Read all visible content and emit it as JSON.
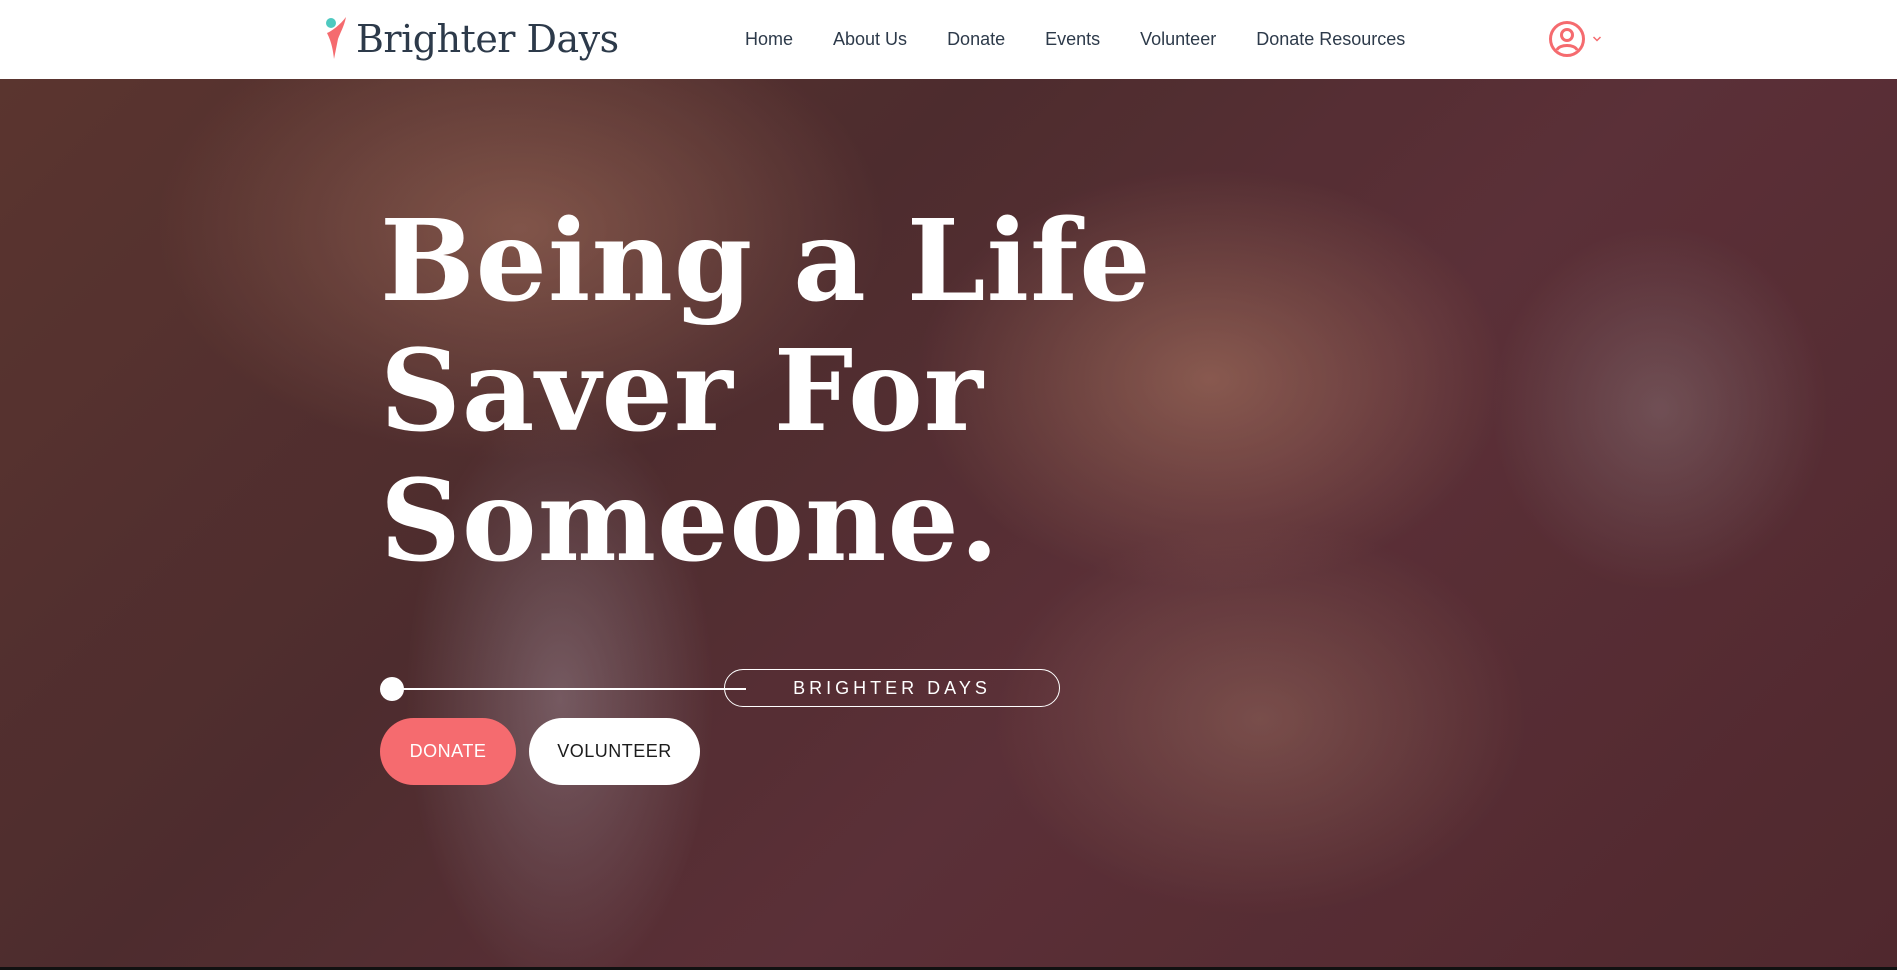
{
  "brand": {
    "name": "Brighter Days",
    "accent_color": "#f56b6f",
    "teal_color": "#4ec9c0",
    "text_color": "#2d3a4a",
    "logo_icon": "figure-icon"
  },
  "nav": {
    "items": [
      {
        "label": "Home"
      },
      {
        "label": "About Us"
      },
      {
        "label": "Donate"
      },
      {
        "label": "Events"
      },
      {
        "label": "Volunteer"
      },
      {
        "label": "Donate Resources"
      }
    ]
  },
  "account": {
    "icon": "user-circle-icon",
    "dropdown_icon": "chevron-down-icon"
  },
  "hero": {
    "title_lines": [
      "Being a Life",
      "Saver For",
      "Someone."
    ],
    "tagline": "BRIGHTER DAYS",
    "background": "photo-stacked-hands",
    "buttons": {
      "donate": "DONATE",
      "volunteer": "VOLUNTEER"
    }
  }
}
